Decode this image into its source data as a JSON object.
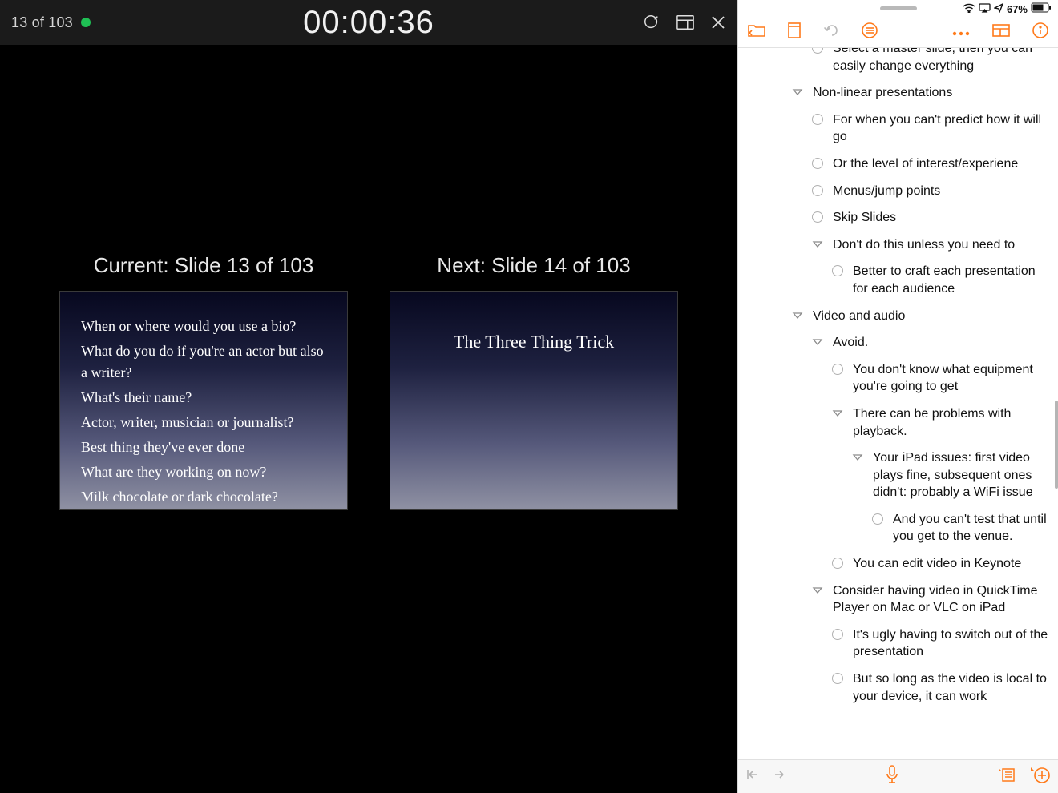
{
  "presenter": {
    "counter": "13 of 103",
    "timer": "00:00:36",
    "current_label": "Current: Slide 13 of 103",
    "next_label": "Next: Slide 14 of 103",
    "current_slide_lines": [
      "When or where would you use a bio?",
      "What do you do if you're an actor but also a writer?",
      "What's their name?",
      "Actor, writer, musician or journalist?",
      "Best thing they've ever done",
      "What are they working on now?",
      "Milk chocolate or dark chocolate?"
    ],
    "next_slide_title": "The Three Thing Trick"
  },
  "status": {
    "battery": "67%"
  },
  "outline": [
    {
      "indent": 2,
      "marker": "circle",
      "text": "Select a master slide, then you can easily change everything"
    },
    {
      "indent": 1,
      "marker": "triangle",
      "text": "Non-linear presentations"
    },
    {
      "indent": 2,
      "marker": "circle",
      "text": "For when you can't predict how it will go"
    },
    {
      "indent": 2,
      "marker": "circle",
      "text": "Or the level of interest/experiene"
    },
    {
      "indent": 2,
      "marker": "circle",
      "text": "Menus/jump points"
    },
    {
      "indent": 2,
      "marker": "circle",
      "text": "Skip Slides"
    },
    {
      "indent": 2,
      "marker": "triangle",
      "text": "Don't do this unless you need to"
    },
    {
      "indent": 3,
      "marker": "circle",
      "text": "Better to craft each presentation for each audience"
    },
    {
      "indent": 1,
      "marker": "triangle",
      "text": "Video and audio"
    },
    {
      "indent": 2,
      "marker": "triangle",
      "text": "Avoid."
    },
    {
      "indent": 3,
      "marker": "circle",
      "text": "You don't know what equipment you're going to get"
    },
    {
      "indent": 3,
      "marker": "triangle",
      "text": "There can be problems with playback."
    },
    {
      "indent": 4,
      "marker": "triangle",
      "text": "Your iPad issues: first video plays fine, subsequent ones didn't: probably a WiFi issue"
    },
    {
      "indent": 5,
      "marker": "circle",
      "text": "And you can't test that until you get to the venue."
    },
    {
      "indent": 3,
      "marker": "circle",
      "text": "You can edit video in Keynote"
    },
    {
      "indent": 2,
      "marker": "triangle",
      "text": "Consider having video in QuickTime Player on Mac or VLC on iPad"
    },
    {
      "indent": 3,
      "marker": "circle",
      "text": "It's ugly having to switch out of the presentation"
    },
    {
      "indent": 3,
      "marker": "circle",
      "text": "But so long as the video is local to your device, it can work"
    }
  ]
}
